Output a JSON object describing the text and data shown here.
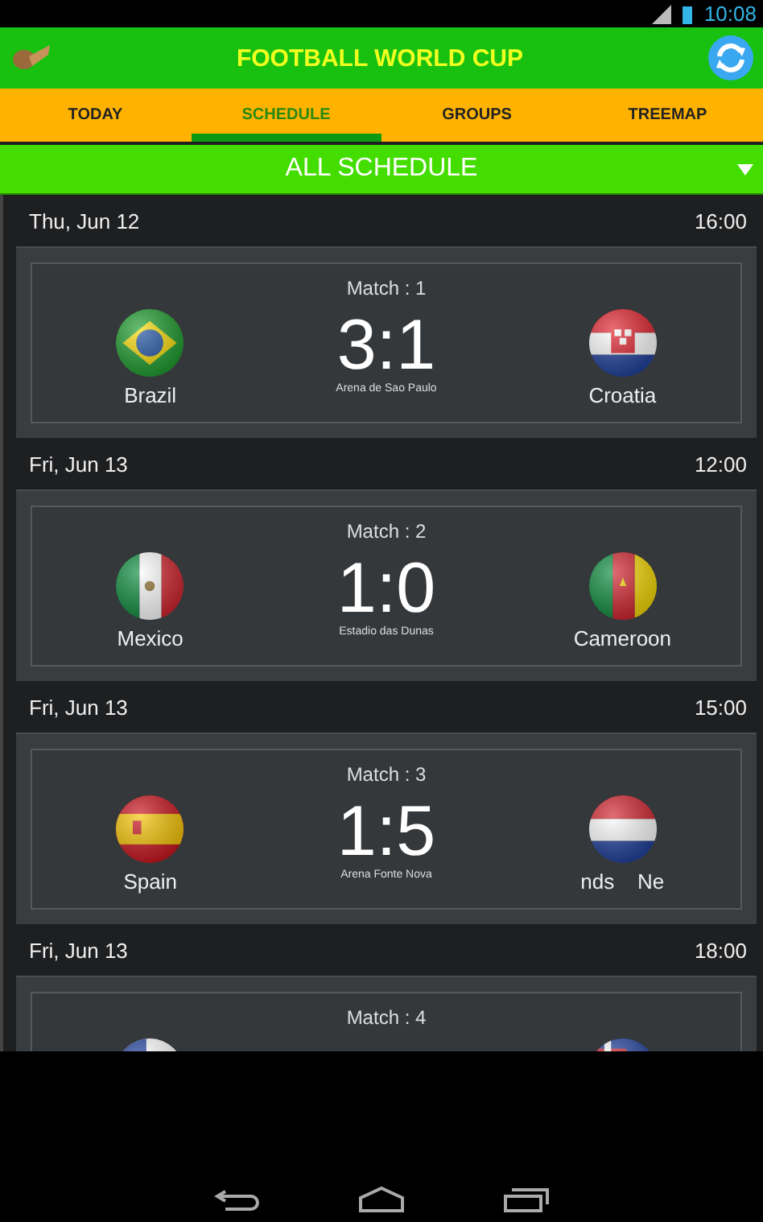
{
  "status_bar": {
    "time": "10:08"
  },
  "app_bar": {
    "title": "FOOTBALL WORLD CUP"
  },
  "tabs": [
    {
      "label": "TODAY",
      "selected": false
    },
    {
      "label": "SCHEDULE",
      "selected": true
    },
    {
      "label": "GROUPS",
      "selected": false
    },
    {
      "label": "TREEMAP",
      "selected": false
    }
  ],
  "filter": {
    "label": "ALL SCHEDULE"
  },
  "matches": [
    {
      "date": "Thu, Jun 12",
      "time": "16:00",
      "match": "Match : 1",
      "home": {
        "name": "Brazil",
        "kind": "brazil"
      },
      "away": {
        "name": "Croatia",
        "kind": "croatia"
      },
      "score": "3:1",
      "venue": "Arena de Sao Paulo"
    },
    {
      "date": "Fri, Jun 13",
      "time": "12:00",
      "match": "Match : 2",
      "home": {
        "name": "Mexico",
        "kind": "mexico"
      },
      "away": {
        "name": "Cameroon",
        "kind": "cameroon"
      },
      "score": "1:0",
      "venue": "Estadio das Dunas"
    },
    {
      "date": "Fri, Jun 13",
      "time": "15:00",
      "match": "Match : 3",
      "home": {
        "name": "Spain",
        "kind": "spain"
      },
      "away": {
        "name": "nds    Ne",
        "kind": "netherlands"
      },
      "score": "1:5",
      "venue": "Arena Fonte Nova"
    },
    {
      "date": "Fri, Jun 13",
      "time": "18:00",
      "match": "Match : 4",
      "home": {
        "kind": "bluewhite"
      },
      "away": {
        "kind": "bluecross"
      }
    }
  ]
}
